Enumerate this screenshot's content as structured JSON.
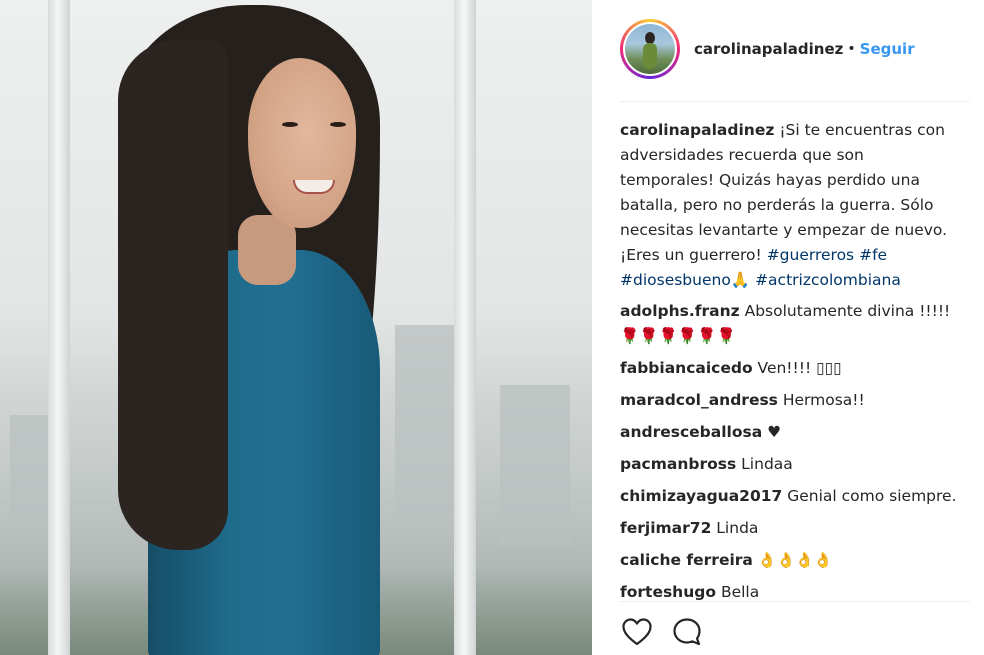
{
  "post": {
    "username": "carolinapaladinez",
    "separator": "•",
    "follow_label": "Seguir"
  },
  "caption": {
    "username": "carolinapaladinez",
    "text": "¡Si te encuentras con adversidades recuerda que son temporales! Quizás hayas perdido una batalla, pero no perderás la guerra. Sólo necesitas levantarte y empezar de nuevo. ¡Eres un guerrero!",
    "hashtags": [
      "#guerreros",
      "#fe",
      "#diosesbueno",
      "#actrizcolombiana"
    ],
    "emoji": "🙏"
  },
  "comments": [
    {
      "user": "adolphs.franz",
      "text": "Absolutamente divina !!!!!",
      "emoji": "🌹🌹🌹🌹🌹🌹"
    },
    {
      "user": "fabbiancaicedo",
      "text": "Ven!!!! ▯▯▯",
      "emoji": ""
    },
    {
      "user": "maradcol_andress",
      "text": "Hermosa!!",
      "emoji": ""
    },
    {
      "user": "andresceballosa",
      "text": "",
      "emoji": "♥"
    },
    {
      "user": "pacmanbross",
      "text": "Lindaa",
      "emoji": ""
    },
    {
      "user": "chimizayagua2017",
      "text": "Genial como siempre.",
      "emoji": ""
    },
    {
      "user": "ferjimar72",
      "text": "Linda",
      "emoji": ""
    },
    {
      "user": "caliche ferreira",
      "text": "",
      "emoji": "👌👌👌👌"
    },
    {
      "user": "forteshugo",
      "text": "Bella",
      "emoji": ""
    }
  ],
  "actions": {
    "like_icon": "heart-icon",
    "comment_icon": "comment-bubble-icon"
  },
  "colors": {
    "link_blue": "#3897f0",
    "hashtag_blue": "#003569",
    "text": "#262626"
  }
}
